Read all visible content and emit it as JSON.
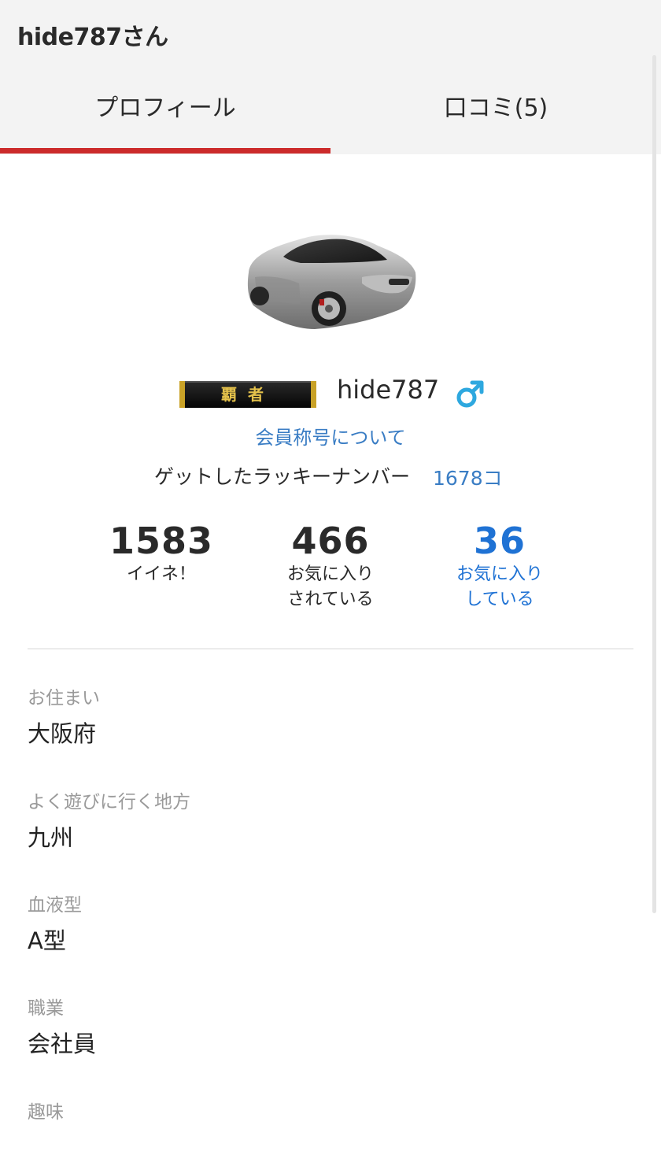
{
  "header": {
    "title": "hide787さん"
  },
  "tabs": [
    {
      "label": "プロフィール",
      "active": true
    },
    {
      "label": "口コミ(5)",
      "active": false
    }
  ],
  "profile": {
    "avatar_icon": "car-avatar",
    "badge_text": "覇者",
    "username": "hide787",
    "gender_icon": "male-icon",
    "member_title_link": "会員称号について",
    "lucky_label": "ゲットしたラッキーナンバー",
    "lucky_count": "1678コ"
  },
  "stats": [
    {
      "value": "1583",
      "label": "イイネ！"
    },
    {
      "value": "466",
      "label": "お気に入り\nされている"
    },
    {
      "value": "36",
      "label": "お気に入り\nしている"
    }
  ],
  "fields": [
    {
      "label": "お住まい",
      "value": "大阪府"
    },
    {
      "label": "よく遊びに行く地方",
      "value": "九州"
    },
    {
      "label": "血液型",
      "value": "A型"
    },
    {
      "label": "職業",
      "value": "会社員"
    },
    {
      "label": "趣味",
      "value": ""
    }
  ],
  "colors": {
    "accent_red": "#cc2b2b",
    "link_blue": "#3a7dc4",
    "stat_blue": "#1f72d4",
    "male_cyan": "#2ea8df"
  }
}
